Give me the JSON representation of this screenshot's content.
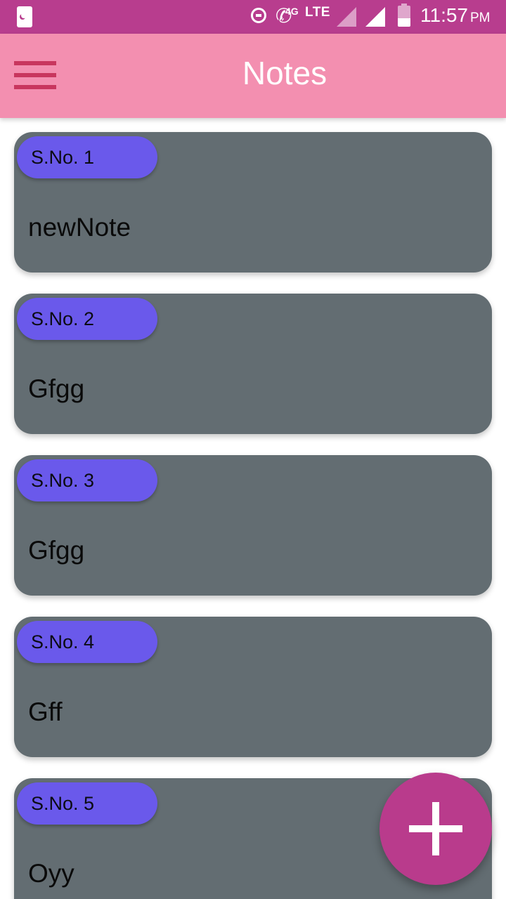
{
  "status_bar": {
    "network_4g": "4G",
    "network_lte": "LTE",
    "time": "11:57",
    "ampm": "PM",
    "battery_level": 0.4,
    "icons": [
      "app-notification-icon",
      "do-not-disturb-icon",
      "volte-call-icon",
      "signal-icon",
      "signal-icon",
      "battery-icon"
    ]
  },
  "app_bar": {
    "title": "Notes",
    "menu_icon": "hamburger-menu-icon"
  },
  "notes": [
    {
      "sno": "S.No. 1",
      "title": "newNote"
    },
    {
      "sno": "S.No. 2",
      "title": "Gfgg"
    },
    {
      "sno": "S.No. 3",
      "title": "Gfgg"
    },
    {
      "sno": "S.No. 4",
      "title": "Gff"
    },
    {
      "sno": "S.No. 5",
      "title": "Oyy"
    }
  ],
  "fab": {
    "icon": "plus-icon"
  },
  "colors": {
    "status_bar": "#b83d8e",
    "app_bar": "#f38fb0",
    "card": "#636d72",
    "badge": "#6a59eb",
    "fab": "#b93b8c"
  }
}
